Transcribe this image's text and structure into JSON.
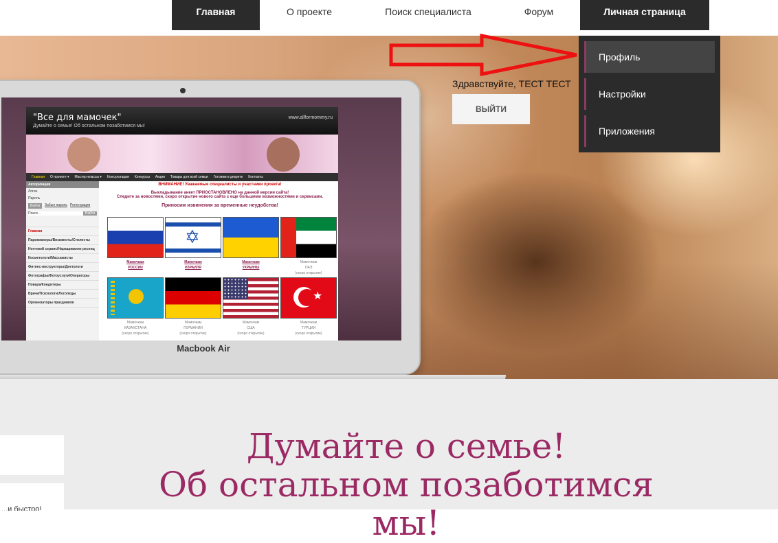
{
  "nav": {
    "items": [
      {
        "label": "Главная"
      },
      {
        "label": "О проекте"
      },
      {
        "label": "Поиск специалиста"
      },
      {
        "label": "Форум"
      },
      {
        "label": "Личная страница"
      }
    ]
  },
  "user": {
    "greeting": "Здравствуйте, ТЕСТ ТЕСТ",
    "logout_label": "ВЫЙТИ"
  },
  "dropdown": {
    "items": [
      {
        "label": "Профиль",
        "active": true
      },
      {
        "label": "Настройки"
      },
      {
        "label": "Приложения"
      }
    ]
  },
  "laptop": {
    "label": "Macbook Air",
    "site": {
      "title": "\"Все для мамочек\"",
      "tagline": "Думайте о семье! Об остальном позаботимся мы!",
      "url": "www.allformommy.ru",
      "menu": [
        "Главная",
        "О проекте ▾",
        "Мастер-классы ▾",
        "Консультации",
        "Конкурсы",
        "Акции",
        "Товары для всей семьи",
        "Готовим в декрете",
        "Контакты"
      ],
      "auth": {
        "title": "Авторизация",
        "login": "Логин",
        "password": "Пароль",
        "enter": "Войти",
        "forgot": "Забыл пароль",
        "register": "Регистрация",
        "search": "Поиск...",
        "find": "Найти"
      },
      "side_menu": [
        "Главная",
        "Парикмахеры/Визажисты/Стилисты",
        "Ногтевой сервис/Наращивание ресниц",
        "Косметологи/Массажисты",
        "Фитнес-инструкторы/Диетологи",
        "Фотографы/Фотоуслуги/Операторы",
        "Повара/Кондитеры",
        "Врачи/Психологи/Логопеды",
        "Организаторы праздников"
      ],
      "notice_title": "ВНИМАНИЕ! Уважаемые специалисты и участники проекта!",
      "notice_1": "Выкладывание анкет ПРИОСТАНОВЛЕНО на данной версии сайта!",
      "notice_2": "Следите за новостями, скоро открытие нового сайта с еще большими возможностями и сервисами.",
      "notice_3": "Приносим извинения за временные неудобства!",
      "flags": [
        {
          "line1": "Мамочкам",
          "line2": "РОССИИ",
          "line3": ""
        },
        {
          "line1": "Мамочкам",
          "line2": "ИЗРАИЛЯ",
          "line3": ""
        },
        {
          "line1": "Мамочкам",
          "line2": "УКРАИНЫ",
          "line3": ""
        },
        {
          "line1": "Мамочкам",
          "line2": "ОАЭ",
          "line3": "(скоро открытие)"
        },
        {
          "line1": "Мамочкам",
          "line2": "КАЗАХСТАНА",
          "line3": "(скоро открытие)"
        },
        {
          "line1": "Мамочкам",
          "line2": "ГЕРМАНИИ",
          "line3": "(скоро открытие)"
        },
        {
          "line1": "Мамочкам",
          "line2": "США",
          "line3": "(скоро открытие)"
        },
        {
          "line1": "Мамочкам",
          "line2": "ТУРЦИИ",
          "line3": "(скоро открытие)"
        }
      ]
    }
  },
  "slogan": {
    "line1": "Думайте о семье!",
    "line2": "Об остальном позаботимся мы!"
  },
  "bottom_left_text": "...и быстро!",
  "colors": {
    "nav_dark": "#2b2b2b",
    "accent": "#9b2a64",
    "arrow": "#ee1111"
  }
}
